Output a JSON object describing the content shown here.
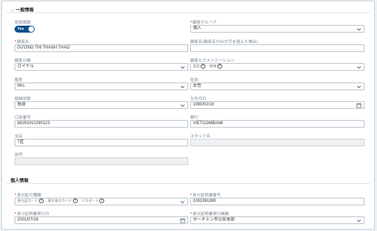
{
  "sections": {
    "general": "一般情報",
    "personal": "個人情報"
  },
  "fields": {
    "tax_exempt": {
      "label": "免税情報",
      "toggle_value": "Yes"
    },
    "customer_group": {
      "label": "顧客グループ",
      "value": "個人"
    },
    "customer_name": {
      "label": "顧客名",
      "value": "DƯƠNG THỊ THANH THẢO"
    },
    "customer_name_alt": {
      "label": "顧客名(顧客名が40文字を超えた場合)",
      "value": ""
    },
    "customer_class": {
      "label": "顧客分類",
      "value": "ロイヤル"
    },
    "customer_segment": {
      "label": "顧客セグメンテーション",
      "chips": [
        "設定",
        "使用"
      ]
    },
    "title": {
      "label": "敬称",
      "value": "Mrs."
    },
    "gender": {
      "label": "性別",
      "value": "女性"
    },
    "marital_status": {
      "label": "婚姻状態",
      "value": "独身"
    },
    "birth_date": {
      "label": "生年月日",
      "value": "1990/02/18"
    },
    "account_number": {
      "label": "口座番号",
      "value": "88291010290123"
    },
    "bank": {
      "label": "銀行",
      "value": "VIETCOMBANK"
    },
    "branch": {
      "label": "支店",
      "value": "7区"
    },
    "staff_name": {
      "label": "スタッフ名",
      "value": ""
    },
    "department": {
      "label": "部門",
      "value": ""
    },
    "id_type": {
      "label": "身分証の種類",
      "chips": [
        "身分証カード",
        "電子身分カード",
        "パスポート"
      ]
    },
    "id_number": {
      "label": "身分証明書番号",
      "value": "0281991890"
    },
    "id_issue_date": {
      "label": "身分証明書発行日",
      "value": "2001/07/26"
    },
    "id_issuer": {
      "label": "身分証明書発行機関",
      "value": "ホーチミン市公安本部"
    }
  },
  "icons": {
    "dropdown": "chevron-down-icon",
    "calendar": "calendar-icon",
    "remove_chip": "close-circle-icon"
  },
  "colors": {
    "toggle_bg": "#0a4d8c",
    "required": "#e0001b"
  }
}
